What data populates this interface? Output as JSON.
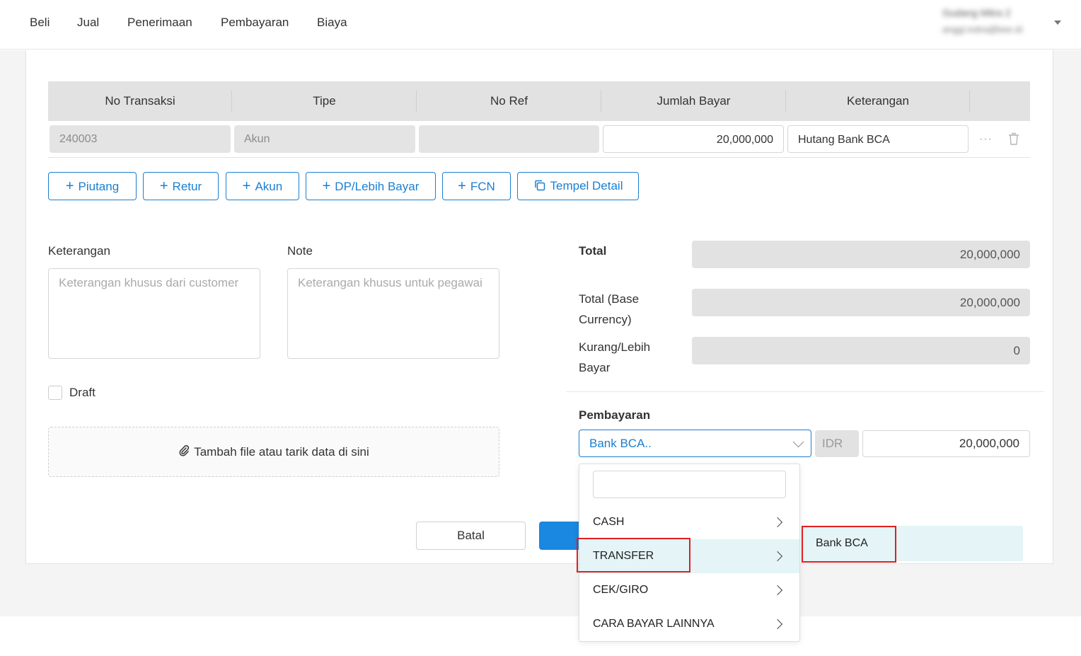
{
  "nav": {
    "items": [
      "Beli",
      "Jual",
      "Penerimaan",
      "Pembayaran",
      "Biaya"
    ],
    "user_name": "Gudang Mitra 2",
    "user_email": "anggi.indra@bee.id"
  },
  "table": {
    "headers": [
      "No Transaksi",
      "Tipe",
      "No Ref",
      "Jumlah Bayar",
      "Keterangan"
    ],
    "row": {
      "no_transaksi": "240003",
      "tipe": "Akun",
      "no_ref": "",
      "jumlah_bayar": "20,000,000",
      "keterangan": "Hutang Bank BCA"
    }
  },
  "add_buttons": {
    "piutang": "Piutang",
    "retur": "Retur",
    "akun": "Akun",
    "dp": "DP/Lebih Bayar",
    "fcn": "FCN",
    "tempel": "Tempel Detail"
  },
  "form": {
    "keterangan_label": "Keterangan",
    "keterangan_placeholder": "Keterangan khusus dari customer",
    "note_label": "Note",
    "note_placeholder": "Keterangan khusus untuk pegawai",
    "draft_label": "Draft",
    "dropzone_text": "Tambah file atau tarik data di sini"
  },
  "totals": {
    "total_label": "Total",
    "total_value": "20,000,000",
    "base_label_1": "Total (Base",
    "base_label_2": "Currency)",
    "base_value": "20,000,000",
    "kurang_label_1": "Kurang/Lebih",
    "kurang_label_2": "Bayar",
    "kurang_value": "0"
  },
  "payment": {
    "label": "Pembayaran",
    "selected": "Bank BCA..",
    "currency": "IDR",
    "amount": "20,000,000"
  },
  "actions": {
    "batal": "Batal"
  },
  "dropdown": {
    "items": [
      "CASH",
      "TRANSFER",
      "CEK/GIRO",
      "CARA BAYAR LAINNYA"
    ],
    "active_index": 1,
    "submenu": [
      "Bank BCA"
    ]
  },
  "colors": {
    "primary": "#1a7fd1",
    "highlight": "#e02020",
    "active_bg": "#e4f4f7"
  }
}
